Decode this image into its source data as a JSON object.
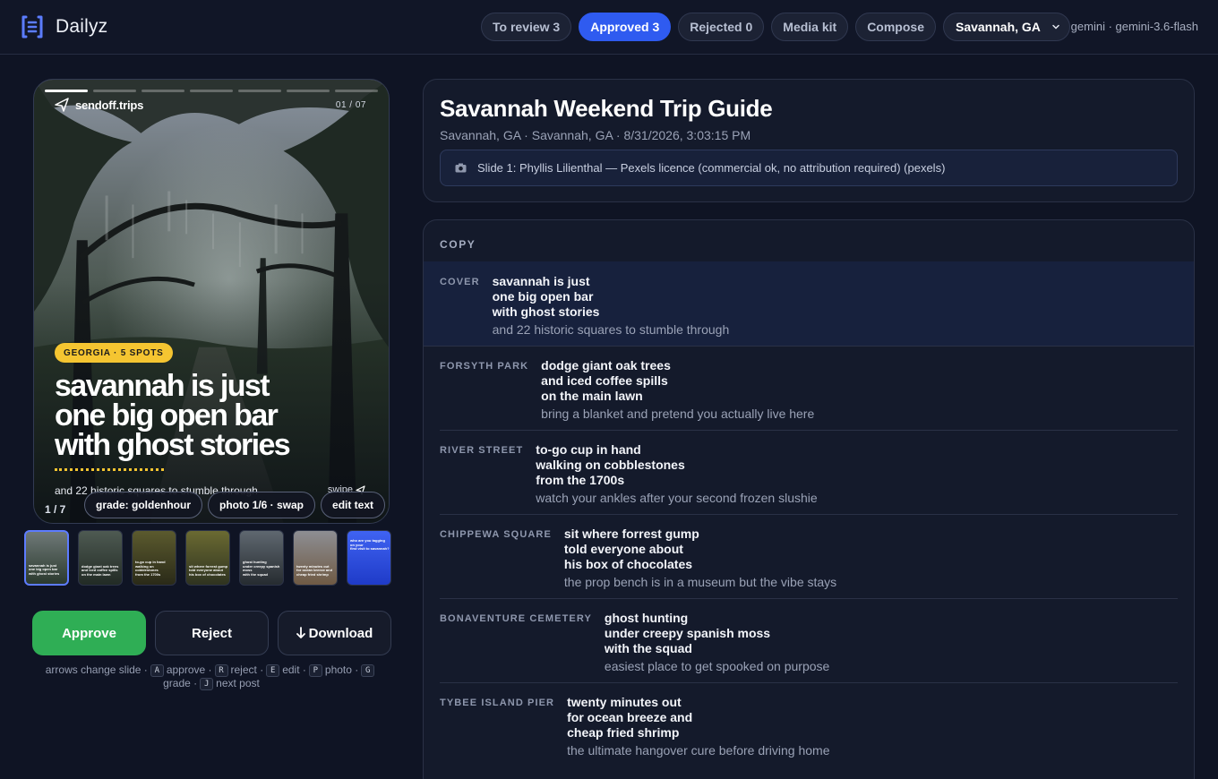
{
  "app": {
    "name": "Dailyz"
  },
  "nav": {
    "tabs": [
      {
        "label": "To review 3"
      },
      {
        "label": "Approved 3",
        "active": true
      },
      {
        "label": "Rejected 0"
      },
      {
        "label": "Media kit"
      },
      {
        "label": "Compose"
      }
    ],
    "location_select": "Savannah, GA",
    "model": "gemini · gemini-3.6-flash"
  },
  "preview": {
    "progress_segments": 7,
    "current_segment": 1,
    "handle": "sendoff.trips",
    "counter": "01 / 07",
    "tag": "GEORGIA · 5 SPOTS",
    "headline": [
      "savannah is just",
      "one big open bar",
      "with ghost stories"
    ],
    "subline": "and 22 historic squares to stumble through",
    "swipe": "swipe",
    "slide_index": "1 / 7",
    "chips": {
      "grade": "grade: goldenhour",
      "photo": "photo 1/6 · swap",
      "edit": "edit text"
    },
    "thumbnails": [
      {
        "text": [
          "savannah is just",
          "one big open bar",
          "with ghost stories"
        ],
        "selected": true
      },
      {
        "text": [
          "dodge giant oak trees",
          "and iced coffee spills",
          "on the main lawn"
        ]
      },
      {
        "text": [
          "to-go cup in hand",
          "walking on cobblestones",
          "from the 1700s"
        ]
      },
      {
        "text": [
          "sit where forrest gump",
          "told everyone about",
          "his box of chocolates"
        ]
      },
      {
        "text": [
          "ghost hunting",
          "under creepy spanish moss",
          "with the squad"
        ]
      },
      {
        "text": [
          "twenty minutes out",
          "for ocean breeze and",
          "cheap fried shrimp"
        ]
      },
      {
        "text": [
          "who are you tagging on your",
          "first visit to savannah?"
        ]
      }
    ]
  },
  "actions": {
    "approve": "Approve",
    "reject": "Reject",
    "download": "Download"
  },
  "hints": {
    "t1": "arrows change slide ·",
    "k1": "A",
    "t2": "approve ·",
    "k2": "R",
    "t3": "reject ·",
    "k3": "E",
    "t4": "edit ·",
    "k4": "P",
    "t5": "photo ·",
    "k5": "G",
    "t6": "grade ·",
    "k6": "J",
    "t7": "next post"
  },
  "post": {
    "title": "Savannah Weekend Trip Guide",
    "meta": "Savannah, GA · Savannah, GA · 8/31/2026, 3:03:15 PM",
    "credit": "Slide 1: Phyllis Lilienthal — Pexels licence (commercial ok, no attribution required) (pexels)"
  },
  "copy": {
    "label": "COPY",
    "rows": [
      {
        "label": "COVER",
        "lines": [
          "savannah is just",
          "one big open bar",
          "with ghost stories"
        ],
        "sub": "and 22 historic squares to stumble through",
        "active": true
      },
      {
        "label": "FORSYTH PARK",
        "lines": [
          "dodge giant oak trees",
          "and iced coffee spills",
          "on the main lawn"
        ],
        "sub": "bring a blanket and pretend you actually live here"
      },
      {
        "label": "RIVER STREET",
        "lines": [
          "to-go cup in hand",
          "walking on cobblestones",
          "from the 1700s"
        ],
        "sub": "watch your ankles after your second frozen slushie"
      },
      {
        "label": "CHIPPEWA SQUARE",
        "lines": [
          "sit where forrest gump",
          "told everyone about",
          "his box of chocolates"
        ],
        "sub": "the prop bench is in a museum but the vibe stays"
      },
      {
        "label": "BONAVENTURE CEMETERY",
        "lines": [
          "ghost hunting",
          "under creepy spanish moss",
          "with the squad"
        ],
        "sub": "easiest place to get spooked on purpose"
      },
      {
        "label": "TYBEE ISLAND PIER",
        "lines": [
          "twenty minutes out",
          "for ocean breeze and",
          "cheap fried shrimp"
        ],
        "sub": "the ultimate hangover cure before driving home"
      }
    ]
  },
  "colors": {
    "accent": "#2f5bf0",
    "approve": "#2fae55",
    "tag": "#f5c531",
    "background": "#0f1424"
  }
}
